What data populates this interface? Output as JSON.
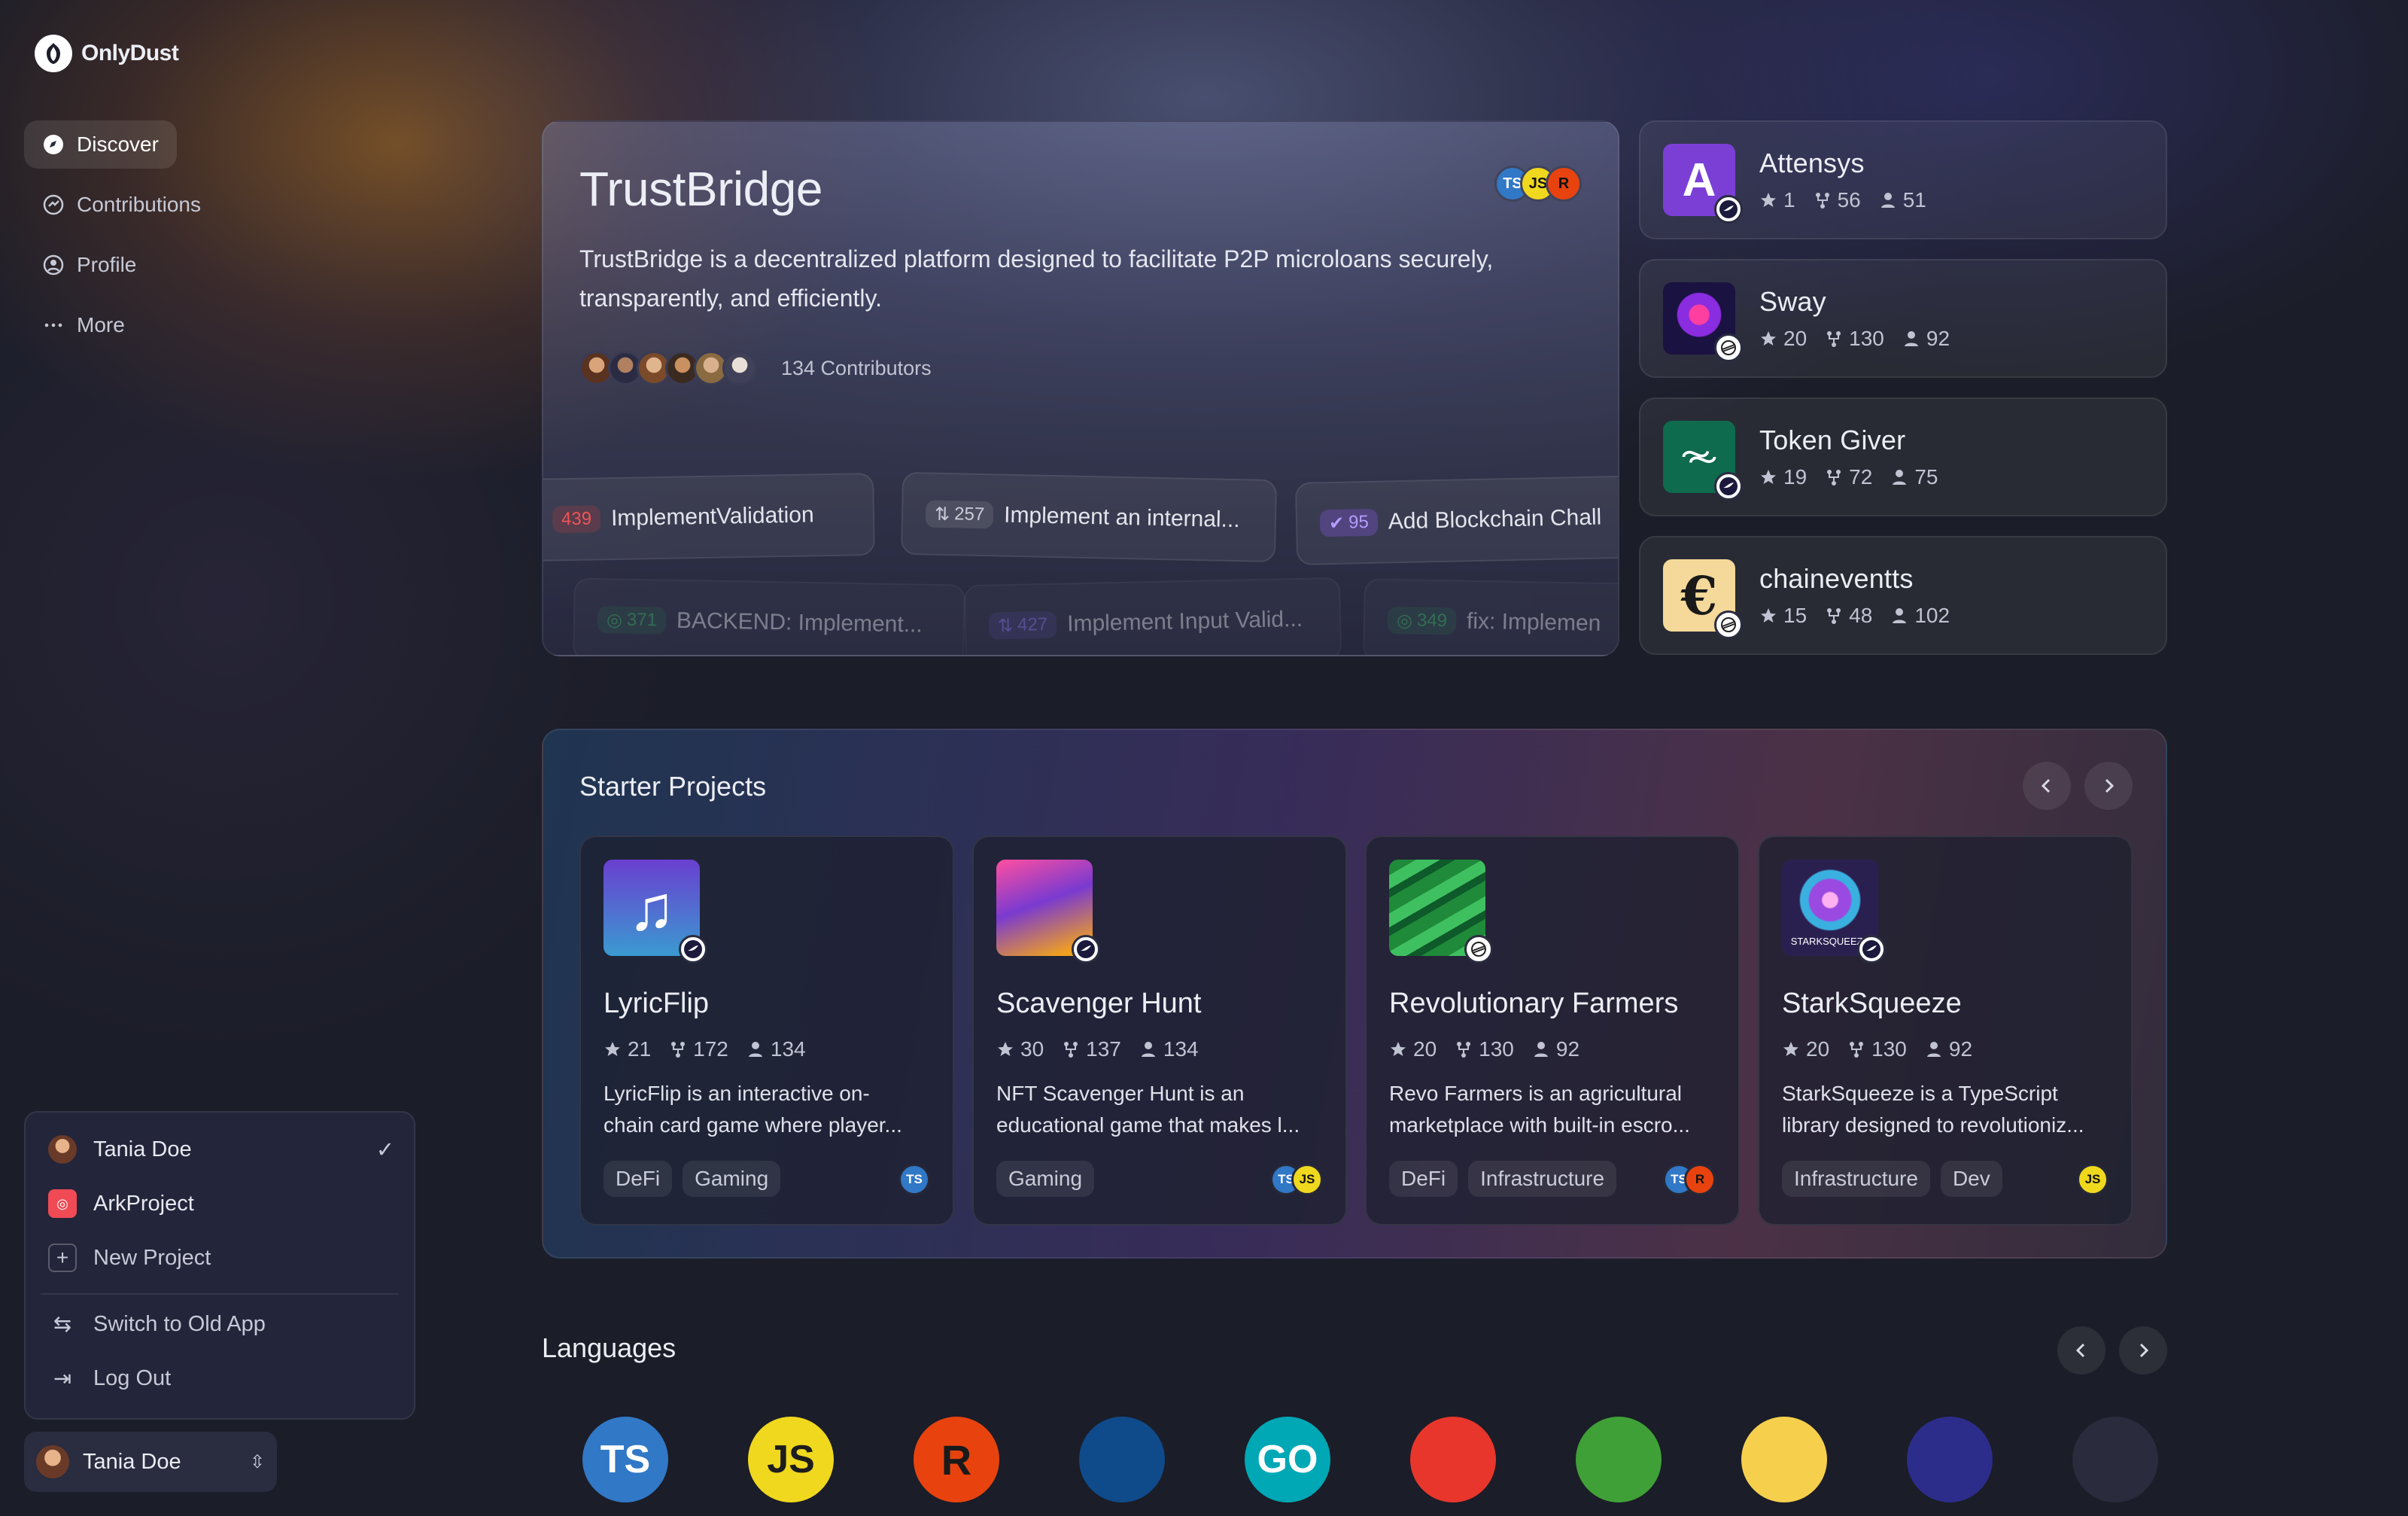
{
  "app": {
    "name": "OnlyDust"
  },
  "nav": {
    "items": [
      {
        "label": "Discover",
        "icon": "compass-icon",
        "active": true
      },
      {
        "label": "Contributions",
        "icon": "contributions-icon"
      },
      {
        "label": "Profile",
        "icon": "profile-icon"
      },
      {
        "label": "More",
        "icon": "ellipsis-icon"
      }
    ]
  },
  "hero": {
    "title": "TrustBridge",
    "description": "TrustBridge is a decentralized platform designed to facilitate P2P microloans securely, transparently, and efficiently.",
    "contributors": "134 Contributors",
    "languages": [
      "TS",
      "JS",
      "R"
    ],
    "issues": [
      {
        "count": "439",
        "label": "ImplementValidation"
      },
      {
        "count": "257",
        "label": "Implement an internal..."
      },
      {
        "count": "95",
        "label": "Add Blockchain Chall"
      },
      {
        "count": "371",
        "label": "BACKEND: Implement..."
      },
      {
        "count": "427",
        "label": "Implement Input Valid..."
      },
      {
        "count": "349",
        "label": "fix: Implemen"
      }
    ]
  },
  "side_projects": [
    {
      "name": "Attensys",
      "stars": "1",
      "forks": "56",
      "contributors": "51",
      "color": "#7b3fd6"
    },
    {
      "name": "Sway",
      "stars": "20",
      "forks": "130",
      "contributors": "92",
      "color": "#1a1240"
    },
    {
      "name": "Token Giver",
      "stars": "19",
      "forks": "72",
      "contributors": "75",
      "color": "#0e6b4d"
    },
    {
      "name": "chaineventts",
      "stars": "15",
      "forks": "48",
      "contributors": "102",
      "color": "#f5d99a"
    }
  ],
  "starter": {
    "title": "Starter Projects",
    "projects": [
      {
        "name": "LyricFlip",
        "stars": "21",
        "forks": "172",
        "contributors": "134",
        "desc_1": "LyricFlip is an interactive on-",
        "desc_2": "chain card game where player...",
        "tags": [
          "DeFi",
          "Gaming"
        ],
        "langs": [
          "TS"
        ]
      },
      {
        "name": "Scavenger Hunt",
        "stars": "30",
        "forks": "137",
        "contributors": "134",
        "desc_1": "NFT Scavenger Hunt is an",
        "desc_2": "educational game that makes l...",
        "tags": [
          "Gaming"
        ],
        "langs": [
          "TS",
          "JS"
        ]
      },
      {
        "name": "Revolutionary Farmers",
        "stars": "20",
        "forks": "130",
        "contributors": "92",
        "desc_1": "Revo Farmers is an agricultural",
        "desc_2": "marketplace with built-in escro...",
        "tags": [
          "DeFi",
          "Infrastructure"
        ],
        "langs": [
          "TS",
          "R"
        ]
      },
      {
        "name": "StarkSqueeze",
        "stars": "20",
        "forks": "130",
        "contributors": "92",
        "desc_1": "StarkSqueeze is a TypeScript",
        "desc_2": "library designed to revolutioniz...",
        "tags": [
          "Infrastructure",
          "Dev"
        ],
        "langs": [
          "JS"
        ],
        "logo_text": "STARKSQUEEZE"
      }
    ]
  },
  "languages": {
    "title": "Languages",
    "items": [
      {
        "label": "TS",
        "icon": "typescript-icon",
        "bg": "#3178c6",
        "fg": "#ffffff"
      },
      {
        "label": "JS",
        "icon": "javascript-icon",
        "bg": "#f0d81e",
        "fg": "#1d1d1d"
      },
      {
        "label": "R",
        "icon": "rust-icon",
        "bg": "#e8430f",
        "fg": "#1a1a1a"
      },
      {
        "label": "",
        "icon": "dart-icon",
        "bg": "#0f4a8a",
        "fg": "#2ea8f0"
      },
      {
        "label": "GO",
        "icon": "go-icon",
        "bg": "#00a7b5",
        "fg": "#ffffff"
      },
      {
        "label": "",
        "icon": "cairo-icon",
        "bg": "#e8362c",
        "fg": "#1a1a1a"
      },
      {
        "label": "",
        "icon": "nodejs-icon",
        "bg": "#3fa037",
        "fg": "#ffffff"
      },
      {
        "label": "",
        "icon": "python-icon",
        "bg": "#f6d04d",
        "fg": "#2b2b2b"
      },
      {
        "label": "",
        "icon": "solidity-icon",
        "bg": "#2c2d8a",
        "fg": "#b7b8f5"
      },
      {
        "label": "",
        "icon": "noir-icon",
        "bg": "#2a2b3c",
        "fg": "#9a9bb0"
      }
    ]
  },
  "user_menu": {
    "accounts": [
      {
        "label": "Tania Doe",
        "selected": true
      },
      {
        "label": "ArkProject"
      },
      {
        "label": "New Project"
      }
    ],
    "switch_label": "Switch to Old App",
    "logout_label": "Log Out"
  },
  "current_user": {
    "name": "Tania Doe"
  }
}
